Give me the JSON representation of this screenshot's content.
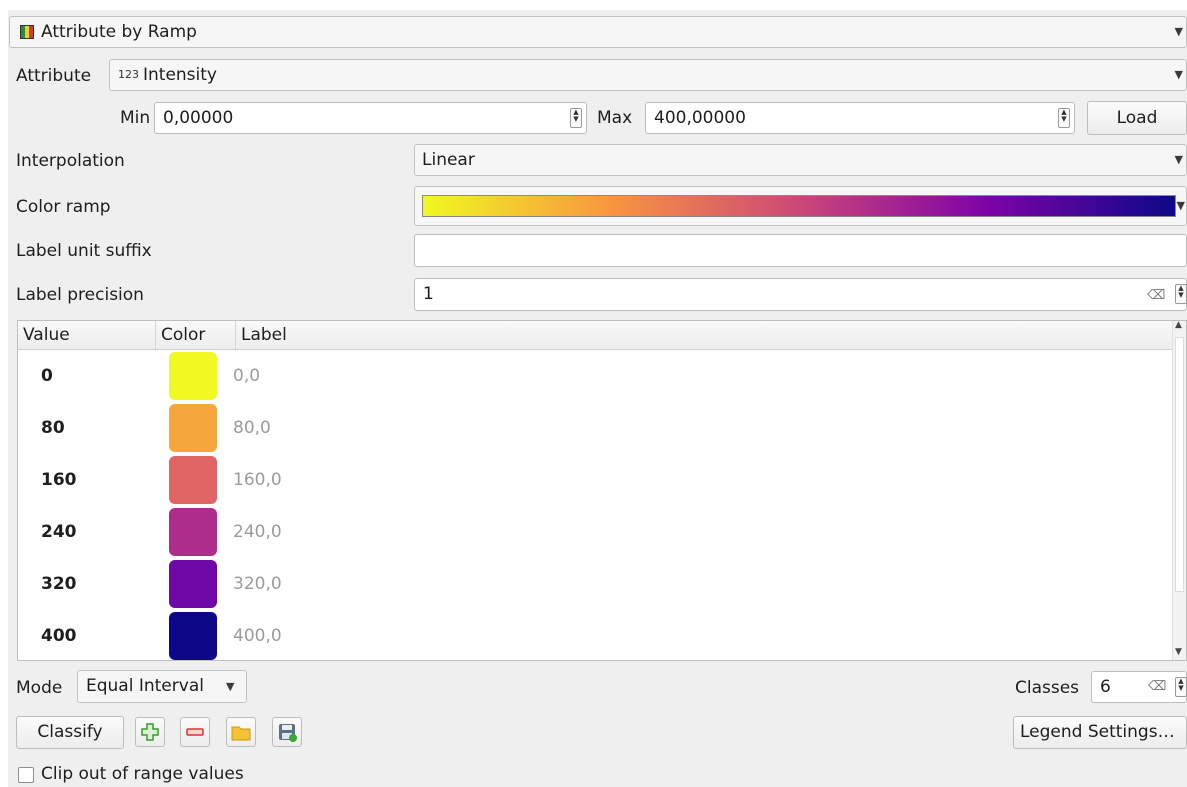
{
  "renderer": {
    "label": "Attribute by Ramp"
  },
  "attribute": {
    "label": "Attribute",
    "type_badge": "123",
    "value": "Intensity"
  },
  "range": {
    "min_label": "Min",
    "min_value": "0,00000",
    "max_label": "Max",
    "max_value": "400,00000",
    "load_label": "Load"
  },
  "interpolation": {
    "label": "Interpolation",
    "value": "Linear"
  },
  "color_ramp": {
    "label": "Color ramp",
    "stops": [
      "#f0f921",
      "#f89540",
      "#cc4778",
      "#7e03a8",
      "#0d0887"
    ]
  },
  "label_unit_suffix": {
    "label": "Label unit suffix",
    "value": ""
  },
  "label_precision": {
    "label": "Label precision",
    "value": "1"
  },
  "table": {
    "headers": [
      "Value",
      "Color",
      "Label"
    ],
    "rows": [
      {
        "value": "0",
        "color": "#f0f921",
        "label": "0,0"
      },
      {
        "value": "80",
        "color": "#f4a53c",
        "label": "80,0"
      },
      {
        "value": "160",
        "color": "#e06464",
        "label": "160,0"
      },
      {
        "value": "240",
        "color": "#ae2d8c",
        "label": "240,0"
      },
      {
        "value": "320",
        "color": "#6f07a6",
        "label": "320,0"
      },
      {
        "value": "400",
        "color": "#0d0887",
        "label": "400,0"
      }
    ]
  },
  "mode": {
    "label": "Mode",
    "value": "Equal Interval"
  },
  "classes": {
    "label": "Classes",
    "value": "6"
  },
  "buttons": {
    "classify": "Classify",
    "legend_settings": "Legend Settings…"
  },
  "icons": {
    "add": "plus-icon",
    "remove": "minus-icon",
    "open": "folder-icon",
    "save": "save-icon"
  },
  "clip": {
    "label": "Clip out of range values",
    "checked": false
  }
}
